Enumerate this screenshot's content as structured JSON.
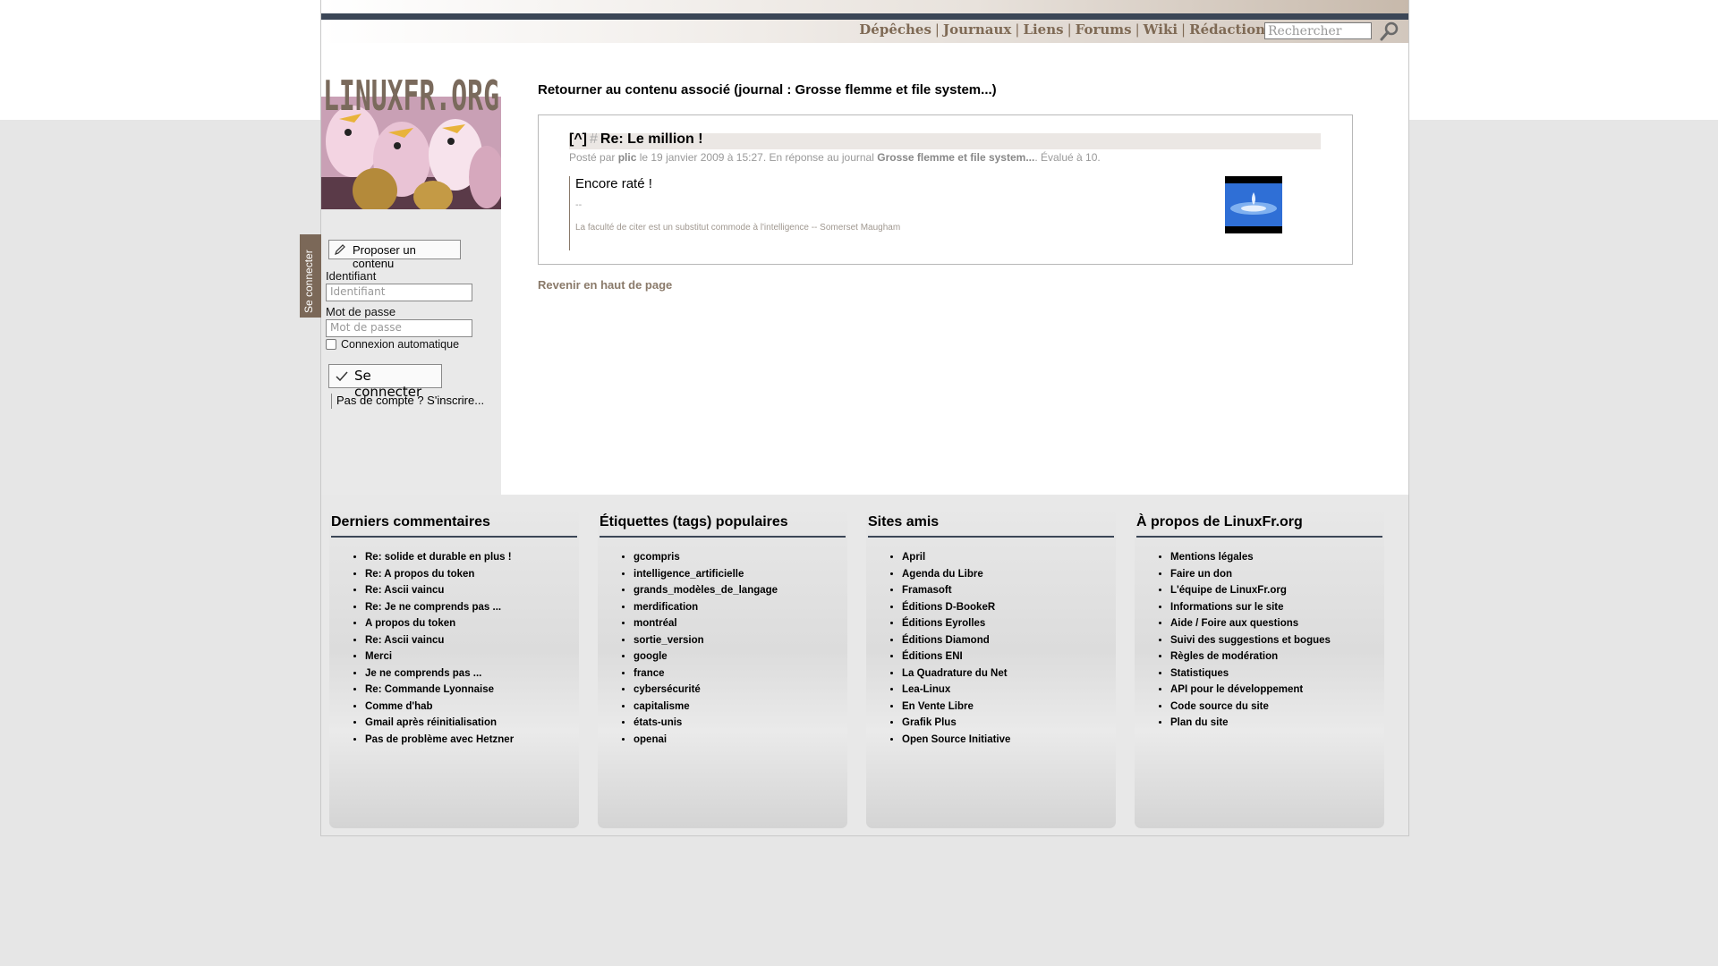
{
  "nav": {
    "items": [
      "Dépêches",
      "Journaux",
      "Liens",
      "Forums",
      "Wiki",
      "Rédaction"
    ],
    "search_placeholder": "Rechercher"
  },
  "sidebar": {
    "logo_text": "LINUXFR.ORG",
    "tab_label": "Se connecter",
    "propose_label": "Proposer un contenu",
    "login_label": "Identifiant",
    "login_placeholder": "Identifiant",
    "password_label": "Mot de passe",
    "password_placeholder": "Mot de passe",
    "remember_label": "Connexion automatique",
    "connect_label": "Se connecter",
    "signup_label": "Pas de compte ? S'inscrire..."
  },
  "main": {
    "back_title": "Retourner au contenu associé (journal : Grosse flemme et file system...)",
    "comment": {
      "anchor": "[^]",
      "hash": "#",
      "title": "Re: Le million !",
      "meta_prefix": "Posté par ",
      "author": "plic",
      "meta_date": " le 19 janvier 2009 à 15:27. En réponse au journal ",
      "journal": "Grosse flemme et file system...",
      "meta_score": ". Évalué à 10.",
      "text": "Encore raté !",
      "sig_dash": "--",
      "signature": "La faculté de citer est un substitut commode à l'intelligence -- Somerset Maugham"
    },
    "top_link": "Revenir en haut de page"
  },
  "footer": {
    "columns": [
      {
        "title": "Derniers commentaires",
        "items": [
          "Re: solide et durable en plus !",
          "Re: A propos du token",
          "Re: Ascii vaincu",
          "Re: Je ne comprends pas ...",
          "A propos du token",
          "Re: Ascii vaincu",
          "Merci",
          "Je ne comprends pas ...",
          "Re: Commande Lyonnaise",
          "Comme d'hab",
          "Gmail après réinitialisation",
          "Pas de problème avec Hetzner"
        ]
      },
      {
        "title": "Étiquettes (tags) populaires",
        "items": [
          "gcompris",
          "intelligence_artificielle",
          "grands_modèles_de_langage",
          "merdification",
          "montréal",
          "sortie_version",
          "google",
          "france",
          "cybersécurité",
          "capitalisme",
          "états-unis",
          "openai"
        ]
      },
      {
        "title": "Sites amis",
        "items": [
          "April",
          "Agenda du Libre",
          "Framasoft",
          "Éditions D-BookeR",
          "Éditions Eyrolles",
          "Éditions Diamond",
          "Éditions ENI",
          "La Quadrature du Net",
          "Lea-Linux",
          "En Vente Libre",
          "Grafik Plus",
          "Open Source Initiative"
        ]
      },
      {
        "title": "À propos de LinuxFr.org",
        "items": [
          "Mentions légales",
          "Faire un don",
          "L'équipe de LinuxFr.org",
          "Informations sur le site",
          "Aide / Foire aux questions",
          "Suivi des suggestions et bogues",
          "Règles de modération",
          "Statistiques",
          "API pour le développement",
          "Code source du site",
          "Plan du site"
        ]
      }
    ]
  },
  "colors": {
    "brand_brown": "#7f6a55",
    "dark_bar": "#3b4656"
  },
  "icons": {
    "search": "magnifier-icon",
    "propose": "pencil-icon",
    "connect": "check-icon"
  }
}
